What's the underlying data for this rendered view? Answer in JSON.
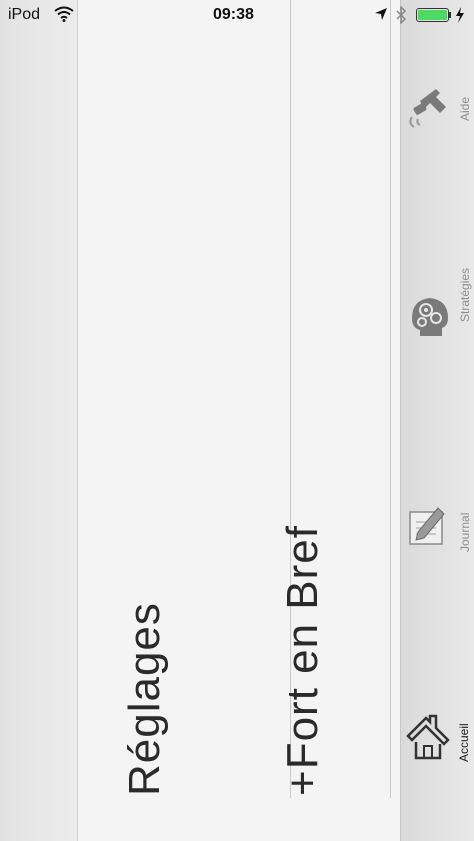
{
  "status_bar": {
    "carrier": "iPod",
    "time": "09:38"
  },
  "menu": {
    "items": [
      {
        "label": "Réglages"
      },
      {
        "label": "+Fort en Bref"
      }
    ]
  },
  "tab_bar": {
    "tabs": [
      {
        "label": "Aide",
        "icon": "megaphone-icon",
        "selected": false
      },
      {
        "label": "Stratégies",
        "icon": "head-gears-icon",
        "selected": false
      },
      {
        "label": "Journal",
        "icon": "notepad-pencil-icon",
        "selected": false
      },
      {
        "label": "Accueil",
        "icon": "house-icon",
        "selected": true
      }
    ]
  },
  "colors": {
    "battery": "#4cd964",
    "icon_gray": "#8e8e8e"
  }
}
